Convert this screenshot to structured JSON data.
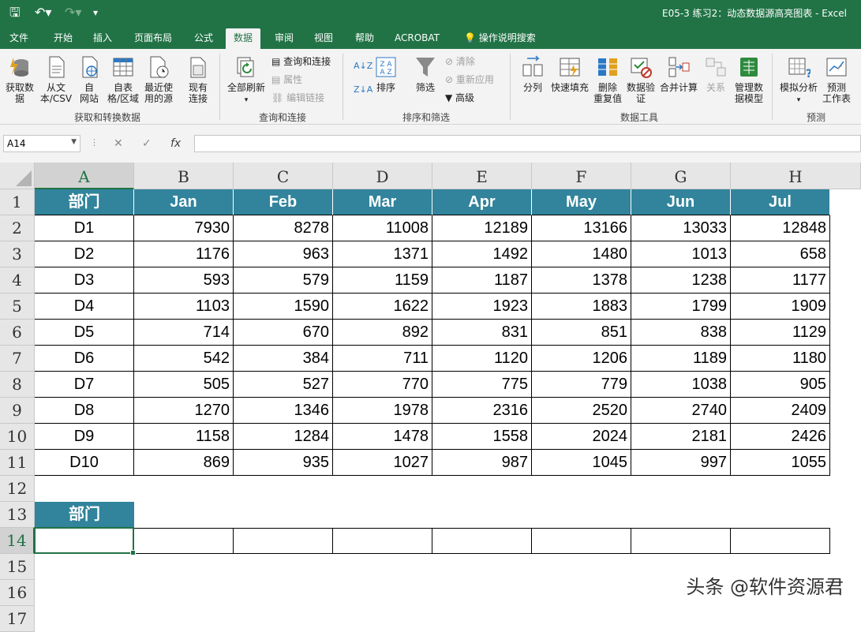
{
  "titlebar": {
    "title": "E05-3 练习2：动态数据源高亮图表 - Excel"
  },
  "tabs": [
    "文件",
    "开始",
    "插入",
    "页面布局",
    "公式",
    "数据",
    "审阅",
    "视图",
    "帮助",
    "ACROBAT",
    "操作说明搜索"
  ],
  "active_tab": "数据",
  "ribbon": {
    "get_data": "获取数\n据",
    "from_text": "从文\n本/CSV",
    "from_web": "自\n网站",
    "from_table": "自表\n格/区域",
    "recent_sources": "最近使\n用的源",
    "existing_conn": "现有\n连接",
    "group_get": "获取和转换数据",
    "refresh_all": "全部刷新",
    "queries_conn": "查询和连接",
    "properties": "属性",
    "edit_links": "编辑链接",
    "group_query": "查询和连接",
    "sort": "排序",
    "filter": "筛选",
    "clear": "清除",
    "reapply": "重新应用",
    "advanced": "高级",
    "group_sort": "排序和筛选",
    "text_to_cols": "分列",
    "flash_fill": "快速填充",
    "remove_dup": "删除\n重复值",
    "validation": "数据验\n证",
    "consolidate": "合并计算",
    "relations": "关系",
    "data_model": "管理数\n据模型",
    "group_tools": "数据工具",
    "what_if": "模拟分析",
    "forecast": "预测\n工作表",
    "group_forecast": "预测"
  },
  "formula_bar": {
    "name_box": "A14",
    "formula": ""
  },
  "columns": [
    "A",
    "B",
    "C",
    "D",
    "E",
    "F",
    "G",
    "H"
  ],
  "rows": [
    "1",
    "2",
    "3",
    "4",
    "5",
    "6",
    "7",
    "8",
    "9",
    "10",
    "11",
    "12",
    "13",
    "14",
    "15",
    "16",
    "17"
  ],
  "table": {
    "header": [
      "部门",
      "Jan",
      "Feb",
      "Mar",
      "Apr",
      "May",
      "Jun",
      "Jul"
    ],
    "data": [
      [
        "D1",
        "7930",
        "8278",
        "11008",
        "12189",
        "13166",
        "13033",
        "12848"
      ],
      [
        "D2",
        "1176",
        "963",
        "1371",
        "1492",
        "1480",
        "1013",
        "658"
      ],
      [
        "D3",
        "593",
        "579",
        "1159",
        "1187",
        "1378",
        "1238",
        "1177"
      ],
      [
        "D4",
        "1103",
        "1590",
        "1622",
        "1923",
        "1883",
        "1799",
        "1909"
      ],
      [
        "D5",
        "714",
        "670",
        "892",
        "831",
        "851",
        "838",
        "1129"
      ],
      [
        "D6",
        "542",
        "384",
        "711",
        "1120",
        "1206",
        "1189",
        "1180"
      ],
      [
        "D7",
        "505",
        "527",
        "770",
        "775",
        "779",
        "1038",
        "905"
      ],
      [
        "D8",
        "1270",
        "1346",
        "1978",
        "2316",
        "2520",
        "2740",
        "2409"
      ],
      [
        "D9",
        "1158",
        "1284",
        "1478",
        "1558",
        "2024",
        "2181",
        "2426"
      ],
      [
        "D10",
        "869",
        "935",
        "1027",
        "987",
        "1045",
        "997",
        "1055"
      ]
    ]
  },
  "second_table": {
    "header": "部门"
  },
  "watermark": "头条 @软件资源君",
  "colors": {
    "excel_green": "#217346",
    "header_teal": "#31849b"
  }
}
